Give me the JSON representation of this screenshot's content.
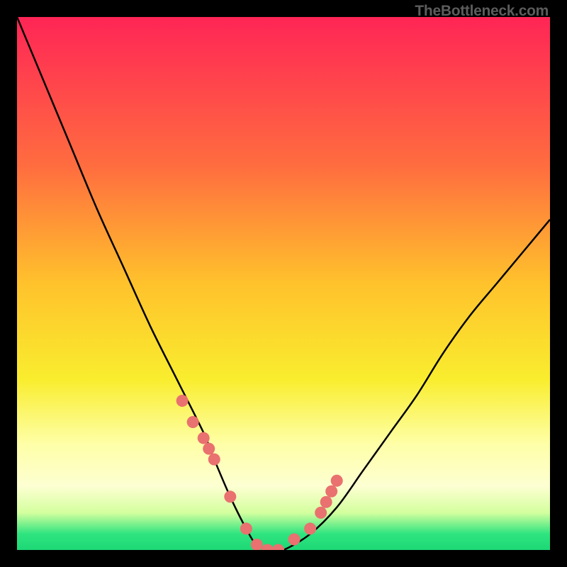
{
  "watermark": "TheBottleneck.com",
  "chart_data": {
    "type": "line",
    "title": "",
    "xlabel": "",
    "ylabel": "",
    "xlim": [
      0,
      100
    ],
    "ylim": [
      0,
      100
    ],
    "curve": {
      "description": "V-shaped bottleneck curve",
      "x": [
        0,
        5,
        10,
        15,
        20,
        25,
        30,
        35,
        37,
        40,
        43,
        45,
        48,
        50,
        55,
        60,
        65,
        70,
        75,
        80,
        85,
        90,
        95,
        100
      ],
      "y": [
        100,
        88,
        76,
        64,
        53,
        42,
        32,
        22,
        17,
        10,
        4,
        1,
        0,
        0,
        3,
        8,
        15,
        22,
        29,
        37,
        44,
        50,
        56,
        62
      ]
    },
    "data_points": {
      "x": [
        31,
        33,
        35,
        36,
        37,
        40,
        43,
        45,
        47,
        49,
        52,
        55,
        57,
        58,
        59,
        60
      ],
      "y": [
        28,
        24,
        21,
        19,
        17,
        10,
        4,
        1,
        0,
        0,
        2,
        4,
        7,
        9,
        11,
        13
      ]
    },
    "gradient_stops": [
      {
        "offset": 0,
        "color": "#ff2556"
      },
      {
        "offset": 0.28,
        "color": "#ff6d3f"
      },
      {
        "offset": 0.5,
        "color": "#ffc22c"
      },
      {
        "offset": 0.68,
        "color": "#f9ed2e"
      },
      {
        "offset": 0.8,
        "color": "#feffa6"
      },
      {
        "offset": 0.88,
        "color": "#fdffd2"
      },
      {
        "offset": 0.93,
        "color": "#d4ff9e"
      },
      {
        "offset": 0.97,
        "color": "#2ee47f"
      },
      {
        "offset": 1.0,
        "color": "#1dd876"
      }
    ],
    "point_color": "#e9716f",
    "point_outline": "#c94d4d",
    "curve_color": "#000000"
  }
}
